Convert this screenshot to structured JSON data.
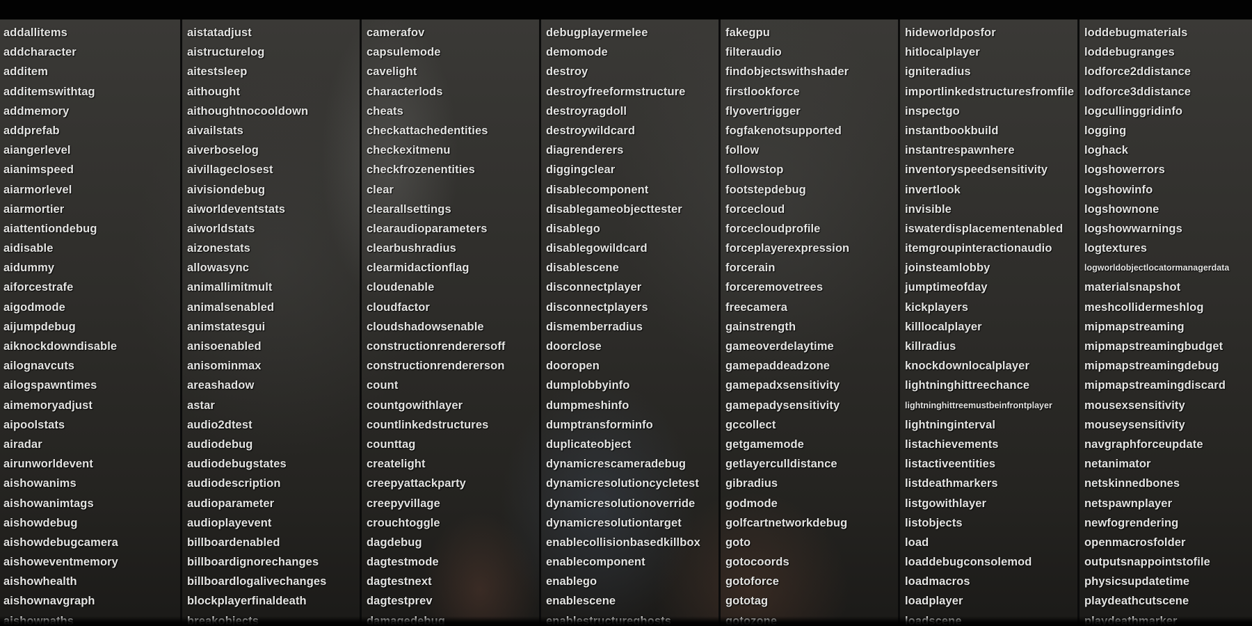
{
  "console": {
    "columns": [
      [
        "addallitems",
        "addcharacter",
        "additem",
        "additemswithtag",
        "addmemory",
        "addprefab",
        "aiangerlevel",
        "aianimspeed",
        "aiarmorlevel",
        "aiarmortier",
        "aiattentiondebug",
        "aidisable",
        "aidummy",
        "aiforcestrafe",
        "aigodmode",
        "aijumpdebug",
        "aiknockdowndisable",
        "ailognavcuts",
        "ailogspawntimes",
        "aimemoryadjust",
        "aipoolstats",
        "airadar",
        "airunworldevent",
        "aishowanims",
        "aishowanimtags",
        "aishowdebug",
        "aishowdebugcamera",
        "aishoweventmemory",
        "aishowhealth",
        "aishownavgraph",
        "aishowpaths"
      ],
      [
        "aistatadjust",
        "aistructurelog",
        "aitestsleep",
        "aithought",
        "aithoughtnocooldown",
        "aivailstats",
        "aiverboselog",
        "aivillageclosest",
        "aivisiondebug",
        "aiworldeventstats",
        "aiworldstats",
        "aizonestats",
        "allowasync",
        "animallimitmult",
        "animalsenabled",
        "animstatesgui",
        "anisoenabled",
        "anisominmax",
        "areashadow",
        "astar",
        "audio2dtest",
        "audiodebug",
        "audiodebugstates",
        "audiodescription",
        "audioparameter",
        "audioplayevent",
        "billboardenabled",
        "billboardignorechanges",
        "billboardlogalivechanges",
        "blockplayerfinaldeath",
        "breakobjects"
      ],
      [
        "camerafov",
        "capsulemode",
        "cavelight",
        "characterlods",
        "cheats",
        "checkattachedentities",
        "checkexitmenu",
        "checkfrozenentities",
        "clear",
        "clearallsettings",
        "clearaudioparameters",
        "clearbushradius",
        "clearmidactionflag",
        "cloudenable",
        "cloudfactor",
        "cloudshadowsenable",
        "constructionrenderersoff",
        "constructionrendererson",
        "count",
        "countgowithlayer",
        "countlinkedstructures",
        "counttag",
        "createlight",
        "creepyattackparty",
        "creepyvillage",
        "crouchtoggle",
        "dagdebug",
        "dagtestmode",
        "dagtestnext",
        "dagtestprev",
        "damagedebug"
      ],
      [
        "debugplayermelee",
        "demomode",
        "destroy",
        "destroyfreeformstructure",
        "destroyragdoll",
        "destroywildcard",
        "diagrenderers",
        "diggingclear",
        "disablecomponent",
        "disablegameobjecttester",
        "disablego",
        "disablegowildcard",
        "disablescene",
        "disconnectplayer",
        "disconnectplayers",
        "dismemberradius",
        "doorclose",
        "dooropen",
        "dumplobbyinfo",
        "dumpmeshinfo",
        "dumptransforminfo",
        "duplicateobject",
        "dynamicrescameradebug",
        "dynamicresolutioncycletest",
        "dynamicresolutionoverride",
        "dynamicresolutiontarget",
        "enablecollisionbasedkillbox",
        "enablecomponent",
        "enablego",
        "enablescene",
        "enablestructureghosts"
      ],
      [
        "fakegpu",
        "filteraudio",
        "findobjectswithshader",
        "firstlookforce",
        "flyovertrigger",
        "fogfakenotsupported",
        "follow",
        "followstop",
        "footstepdebug",
        "forcecloud",
        "forcecloudprofile",
        "forceplayerexpression",
        "forcerain",
        "forceremovetrees",
        "freecamera",
        "gainstrength",
        "gameoverdelaytime",
        "gamepaddeadzone",
        "gamepadxsensitivity",
        "gamepadysensitivity",
        "gccollect",
        "getgamemode",
        "getlayerculldistance",
        "gibradius",
        "godmode",
        "golfcartnetworkdebug",
        "goto",
        "gotocoords",
        "gotoforce",
        "gototag",
        "gotozone"
      ],
      [
        "hideworldposfor",
        "hitlocalplayer",
        "igniteradius",
        "importlinkedstructuresfromfile",
        "inspectgo",
        "instantbookbuild",
        "instantrespawnhere",
        "inventoryspeedsensitivity",
        "invertlook",
        "invisible",
        "iswaterdisplacementenabled",
        "itemgroupinteractionaudio",
        "joinsteamlobby",
        "jumptimeofday",
        "kickplayers",
        "killlocalplayer",
        "killradius",
        "knockdownlocalplayer",
        "lightninghittreechance",
        "lightninghittreemustbeinfrontplayer",
        "lightninginterval",
        "listachievements",
        "listactiveentities",
        "listdeathmarkers",
        "listgowithlayer",
        "listobjects",
        "load",
        "loaddebugconsolemod",
        "loadmacros",
        "loadplayer",
        "loadscene"
      ],
      [
        "loddebugmaterials",
        "loddebugranges",
        "lodforce2ddistance",
        "lodforce3ddistance",
        "logcullinggridinfo",
        "logging",
        "loghack",
        "logshowerrors",
        "logshowinfo",
        "logshownone",
        "logshowwarnings",
        "logtextures",
        "logworldobjectlocatormanagerdata",
        "materialsnapshot",
        "meshcollidermeshlog",
        "mipmapstreaming",
        "mipmapstreamingbudget",
        "mipmapstreamingdebug",
        "mipmapstreamingdiscard",
        "mousexsensitivity",
        "mouseysensitivity",
        "navgraphforceupdate",
        "netanimator",
        "netskinnedbones",
        "netspawnplayer",
        "newfogrendering",
        "openmacrosfolder",
        "outputsnappointstofile",
        "physicsupdatetime",
        "playdeathcutscene",
        "playdeathmarker"
      ]
    ],
    "small_font_commands": [
      "lightninghittreemustbeinfrontplayer",
      "logworldobjectlocatormanagerdata"
    ]
  }
}
